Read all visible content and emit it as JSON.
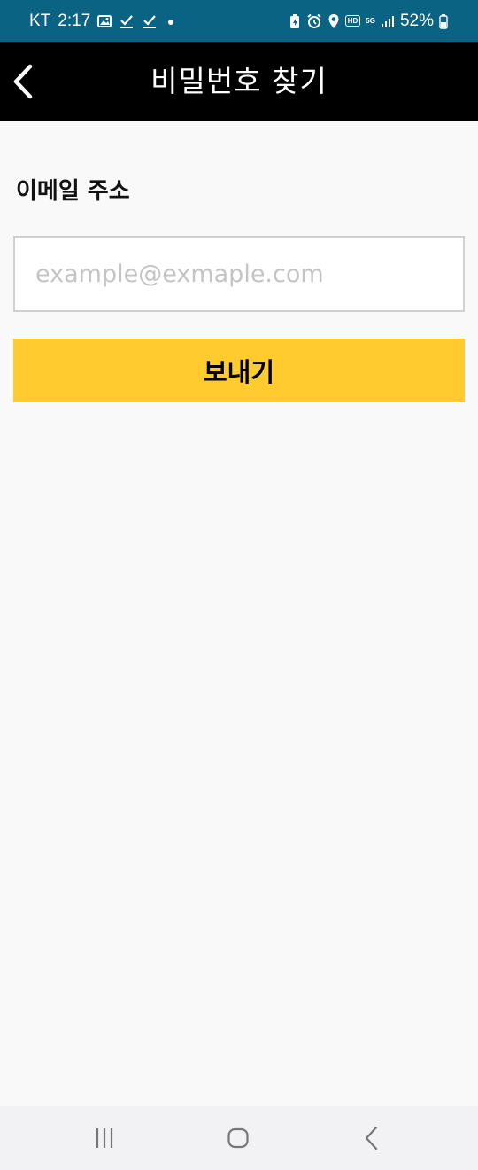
{
  "status_bar": {
    "carrier": "KT",
    "time": "2:17",
    "battery_percent": "52%",
    "icons_left": [
      "image-icon",
      "check-icon",
      "check-icon",
      "dot-icon"
    ],
    "icons_right": [
      "battery-saver-icon",
      "alarm-icon",
      "location-icon",
      "hd-icon",
      "5g-icon",
      "signal-icon",
      "battery-icon"
    ],
    "hd_label": "HD",
    "network_label": "5G"
  },
  "header": {
    "title": "비밀번호 찾기",
    "back_icon": "chevron-left-icon"
  },
  "form": {
    "email_label": "이메일 주소",
    "email_placeholder": "example@exmaple.com",
    "email_value": "",
    "send_label": "보내기",
    "send_color": "#ffcb2f"
  },
  "nav_bar": {
    "buttons": [
      "recent-apps-icon",
      "home-icon",
      "back-icon"
    ]
  },
  "colors": {
    "status_bar": "#0b6384",
    "header_bg": "#000000",
    "page_bg": "#f9f9f9",
    "accent": "#ffcb2f"
  }
}
